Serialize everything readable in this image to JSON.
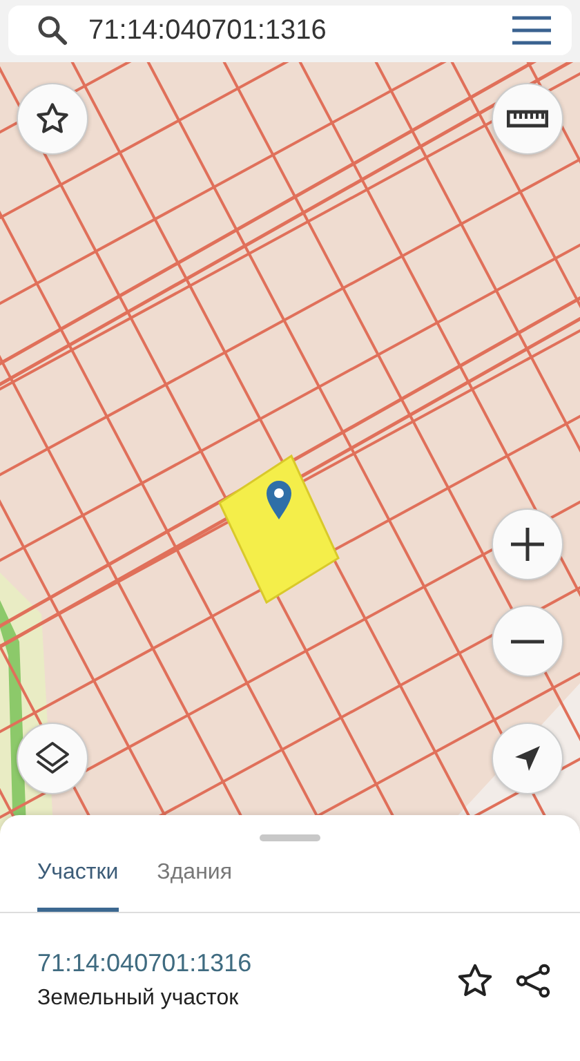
{
  "search": {
    "value": "71:14:040701:1316"
  },
  "tabs": [
    {
      "label": "Участки",
      "selected": true
    },
    {
      "label": "Здания",
      "selected": false
    }
  ],
  "result": {
    "number": "71:14:040701:1316",
    "type": "Земельный участок"
  }
}
